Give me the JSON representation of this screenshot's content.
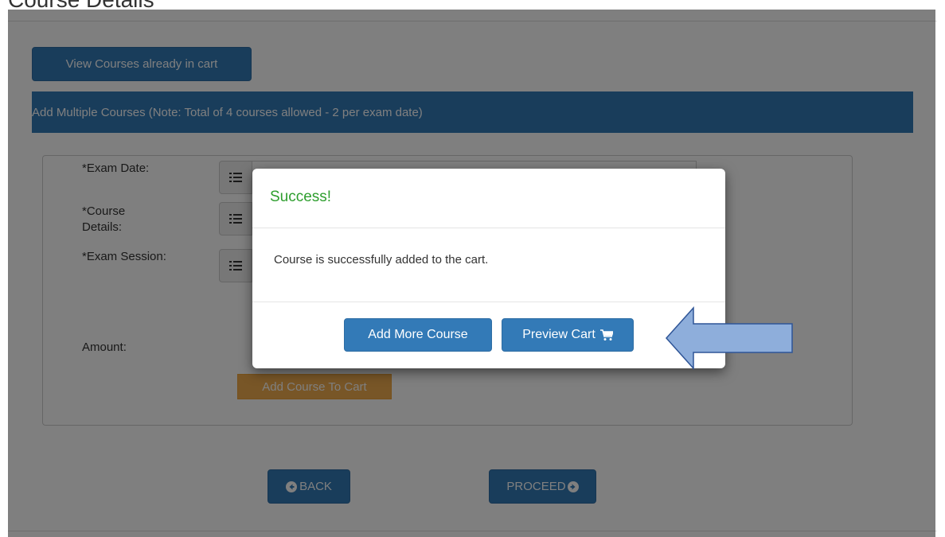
{
  "page": {
    "heading": "Course Details",
    "view_cart_label": "View Courses already in cart",
    "banner_text": "Add Multiple Courses (Note: Total of 4 courses allowed - 2 per exam date)",
    "form": {
      "exam_date_label": "*Exam Date:",
      "course_details_label": "*Course Details:",
      "exam_session_label": "*Exam Session:",
      "amount_label": "Amount:",
      "add_course_label": "Add Course To Cart"
    },
    "back_label": "BACK",
    "proceed_label": "PROCEED"
  },
  "modal": {
    "title": "Success!",
    "message": "Course is successfully added to the cart.",
    "add_more_label": "Add More Course",
    "preview_label": "Preview Cart"
  },
  "colors": {
    "primary": "#337ab7",
    "success_text": "#2e9e2e",
    "warning": "#f0ad4e",
    "arrow_fill": "#8eaedb",
    "arrow_stroke": "#2f5597"
  },
  "icons": [
    "list-icon",
    "cart-icon",
    "circle-arrow-left-icon",
    "circle-arrow-right-icon",
    "arrow-left-icon"
  ]
}
